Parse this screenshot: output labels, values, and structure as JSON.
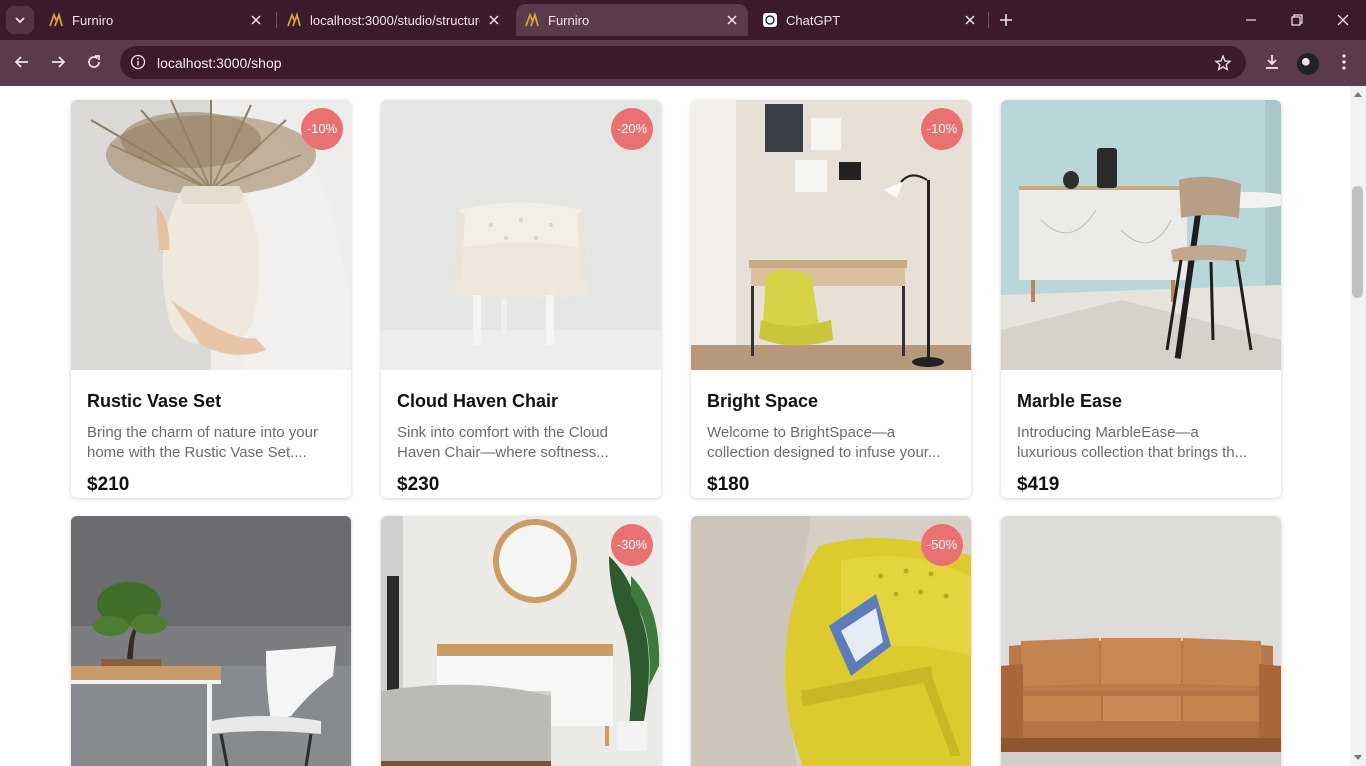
{
  "browser": {
    "tabs": [
      {
        "title": "Furniro",
        "active": false
      },
      {
        "title": "localhost:3000/studio/structure/",
        "active": false
      },
      {
        "title": "Furniro",
        "active": true
      },
      {
        "title": "ChatGPT",
        "active": false
      }
    ],
    "url": "localhost:3000/shop"
  },
  "colors": {
    "chrome_dark": "#3b1a2b",
    "chrome_mid": "#5a3a4b",
    "badge": "#e97171"
  },
  "products": [
    {
      "name": "Rustic Vase Set",
      "desc_line1": "Bring the charm of nature into your",
      "desc_line2": "home with the Rustic Vase Set....",
      "price": "$210",
      "discount": "-10%"
    },
    {
      "name": "Cloud Haven Chair",
      "desc_line1": "Sink into comfort with the Cloud",
      "desc_line2": "Haven Chair—where softness...",
      "price": "$230",
      "discount": "-20%"
    },
    {
      "name": "Bright Space",
      "desc_line1": "Welcome to BrightSpace—a",
      "desc_line2": "collection designed to infuse your...",
      "price": "$180",
      "discount": "-10%"
    },
    {
      "name": "Marble Ease",
      "desc_line1": "Introducing MarbleEase—a",
      "desc_line2": "luxurious collection that brings th...",
      "price": "$419",
      "discount": ""
    },
    {
      "name": "",
      "discount": ""
    },
    {
      "name": "",
      "discount": "-30%"
    },
    {
      "name": "",
      "discount": "-50%"
    },
    {
      "name": "",
      "discount": ""
    }
  ]
}
